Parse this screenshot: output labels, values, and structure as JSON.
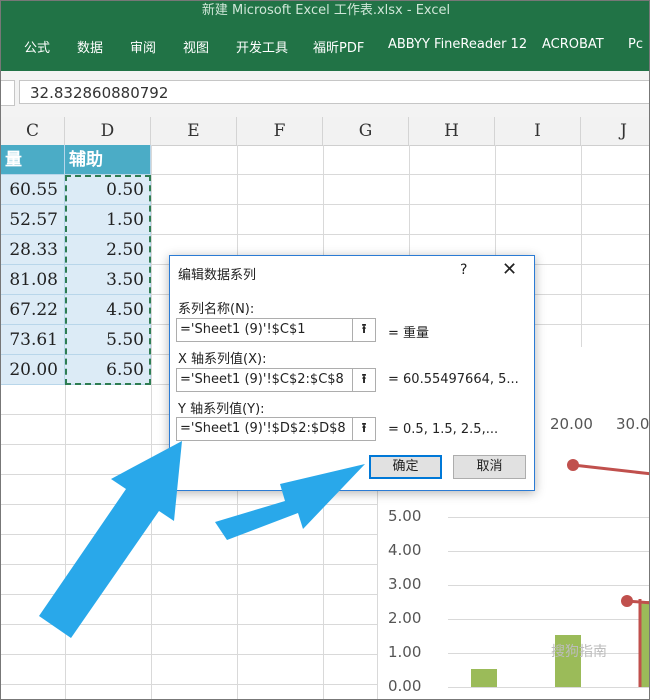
{
  "window": {
    "title": "新建 Microsoft Excel 工作表.xlsx  -  Excel"
  },
  "ribbon": {
    "tabs": [
      "公式",
      "数据",
      "审阅",
      "视图",
      "开发工具",
      "福昕PDF",
      "ABBYY FineReader 12",
      "ACROBAT",
      "Pc"
    ]
  },
  "formula_bar": {
    "value": "32.832860880792"
  },
  "columns": [
    "C",
    "D",
    "E",
    "F",
    "G",
    "H",
    "I",
    "J"
  ],
  "sheet": {
    "header_c": "量",
    "header_d": "辅助",
    "c_values": [
      "60.55",
      "52.57",
      "28.33",
      "81.08",
      "67.22",
      "73.61",
      "20.00"
    ],
    "d_values": [
      "0.50",
      "1.50",
      "2.50",
      "3.50",
      "4.50",
      "5.50",
      "6.50"
    ]
  },
  "chart": {
    "y_ticks": [
      "5.00",
      "4.00",
      "3.00",
      "2.00",
      "1.00",
      "0.00"
    ],
    "x_ticks": [
      "20.00",
      "30.0"
    ],
    "colors": {
      "bar": "#9bbb59",
      "line": "#c0504d",
      "grid": "#d9d9d9"
    }
  },
  "chart_data": {
    "type": "bar",
    "ylim": [
      0,
      5.5
    ],
    "y_ticks": [
      5,
      4,
      3,
      2,
      1,
      0
    ],
    "x_ticks": [
      20,
      30
    ],
    "bar_values": [
      0.5,
      1.5,
      2.5
    ],
    "line_points_y": [
      6.5,
      2.5
    ]
  },
  "dialog": {
    "title": "编辑数据系列",
    "help": "?",
    "close": "✕",
    "series_name_label": "系列名称(N):",
    "series_name_ref": "='Sheet1 (9)'!$C$1",
    "series_name_preview": "= 重量",
    "x_label": "X 轴系列值(X):",
    "x_ref": "='Sheet1 (9)'!$C$2:$C$8",
    "x_preview": "= 60.55497664, 5...",
    "y_label": "Y 轴系列值(Y):",
    "y_ref": "='Sheet1 (9)'!$D$2:$D$8",
    "y_preview": "= 0.5, 1.5, 2.5,...",
    "ok": "确定",
    "cancel": "取消",
    "collapse_glyph": "⭱"
  },
  "watermark": "搜狗指南"
}
